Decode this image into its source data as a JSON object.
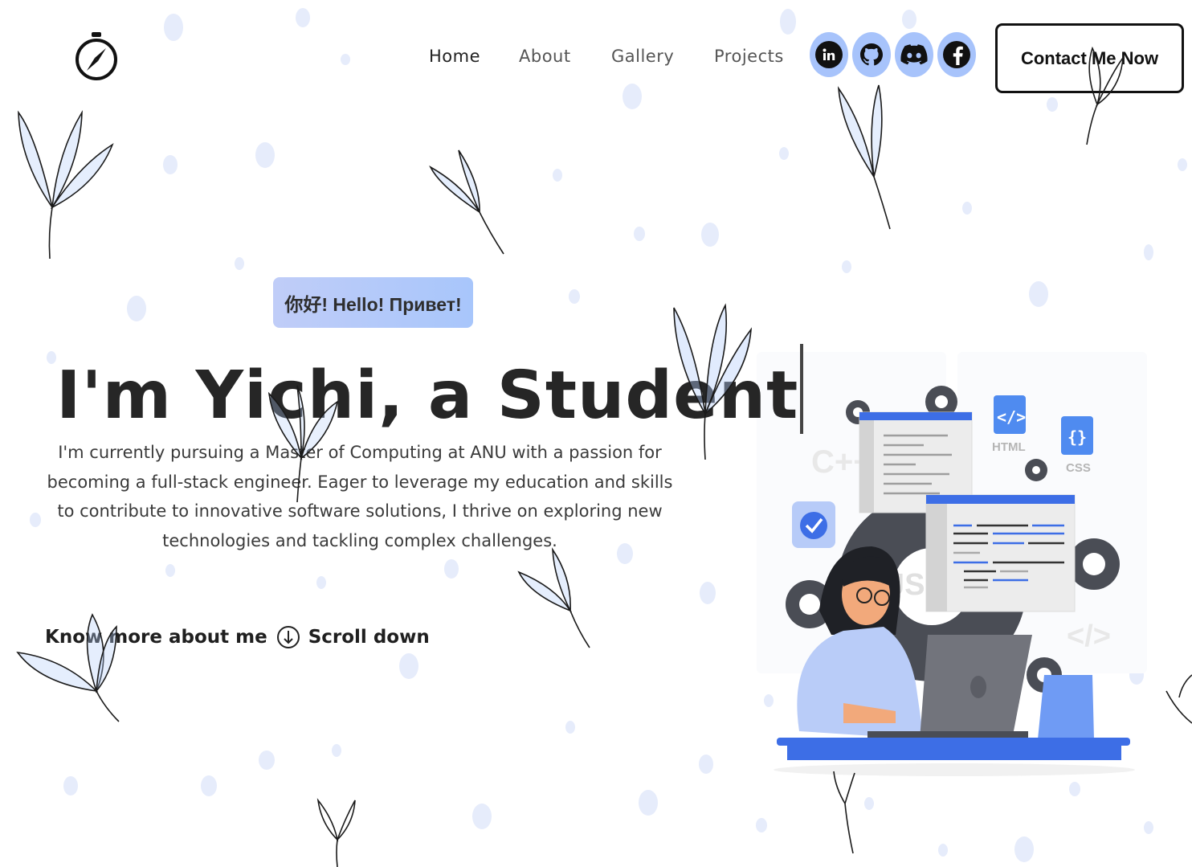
{
  "header": {
    "logo_icon": "compass-icon",
    "nav": [
      "Home",
      "About",
      "Gallery",
      "Projects"
    ],
    "active_nav": "Home",
    "social": [
      {
        "name": "linkedin",
        "icon": "linkedin-icon"
      },
      {
        "name": "github",
        "icon": "github-icon"
      },
      {
        "name": "discord",
        "icon": "discord-icon"
      },
      {
        "name": "facebook",
        "icon": "facebook-icon"
      }
    ],
    "contact_label": "Contact Me Now"
  },
  "hero": {
    "greeting": "你好! Hello! Привет!",
    "title": "I'm Yichi, a Student",
    "description": "I'm currently pursuing a Master of Computing at ANU with a passion for becoming a full-stack engineer. Eager to leverage my education and skills to contribute to innovative software solutions, I thrive on exploring new technologies and tackling complex challenges.",
    "cta_primary": "Know more about me",
    "cta_secondary": "Scroll down",
    "scroll_icon": "arrow-down-circle-icon"
  },
  "illustration": {
    "labels": {
      "html": "HTML",
      "css": "CSS",
      "cpp": "C++",
      "js": "JS",
      "tag": "</>",
      "braces": "{}"
    }
  },
  "colors": {
    "accent": "#a7c3fb",
    "accent_dark": "#3d6ee6",
    "text": "#262626",
    "dots": "#e3eafc"
  }
}
